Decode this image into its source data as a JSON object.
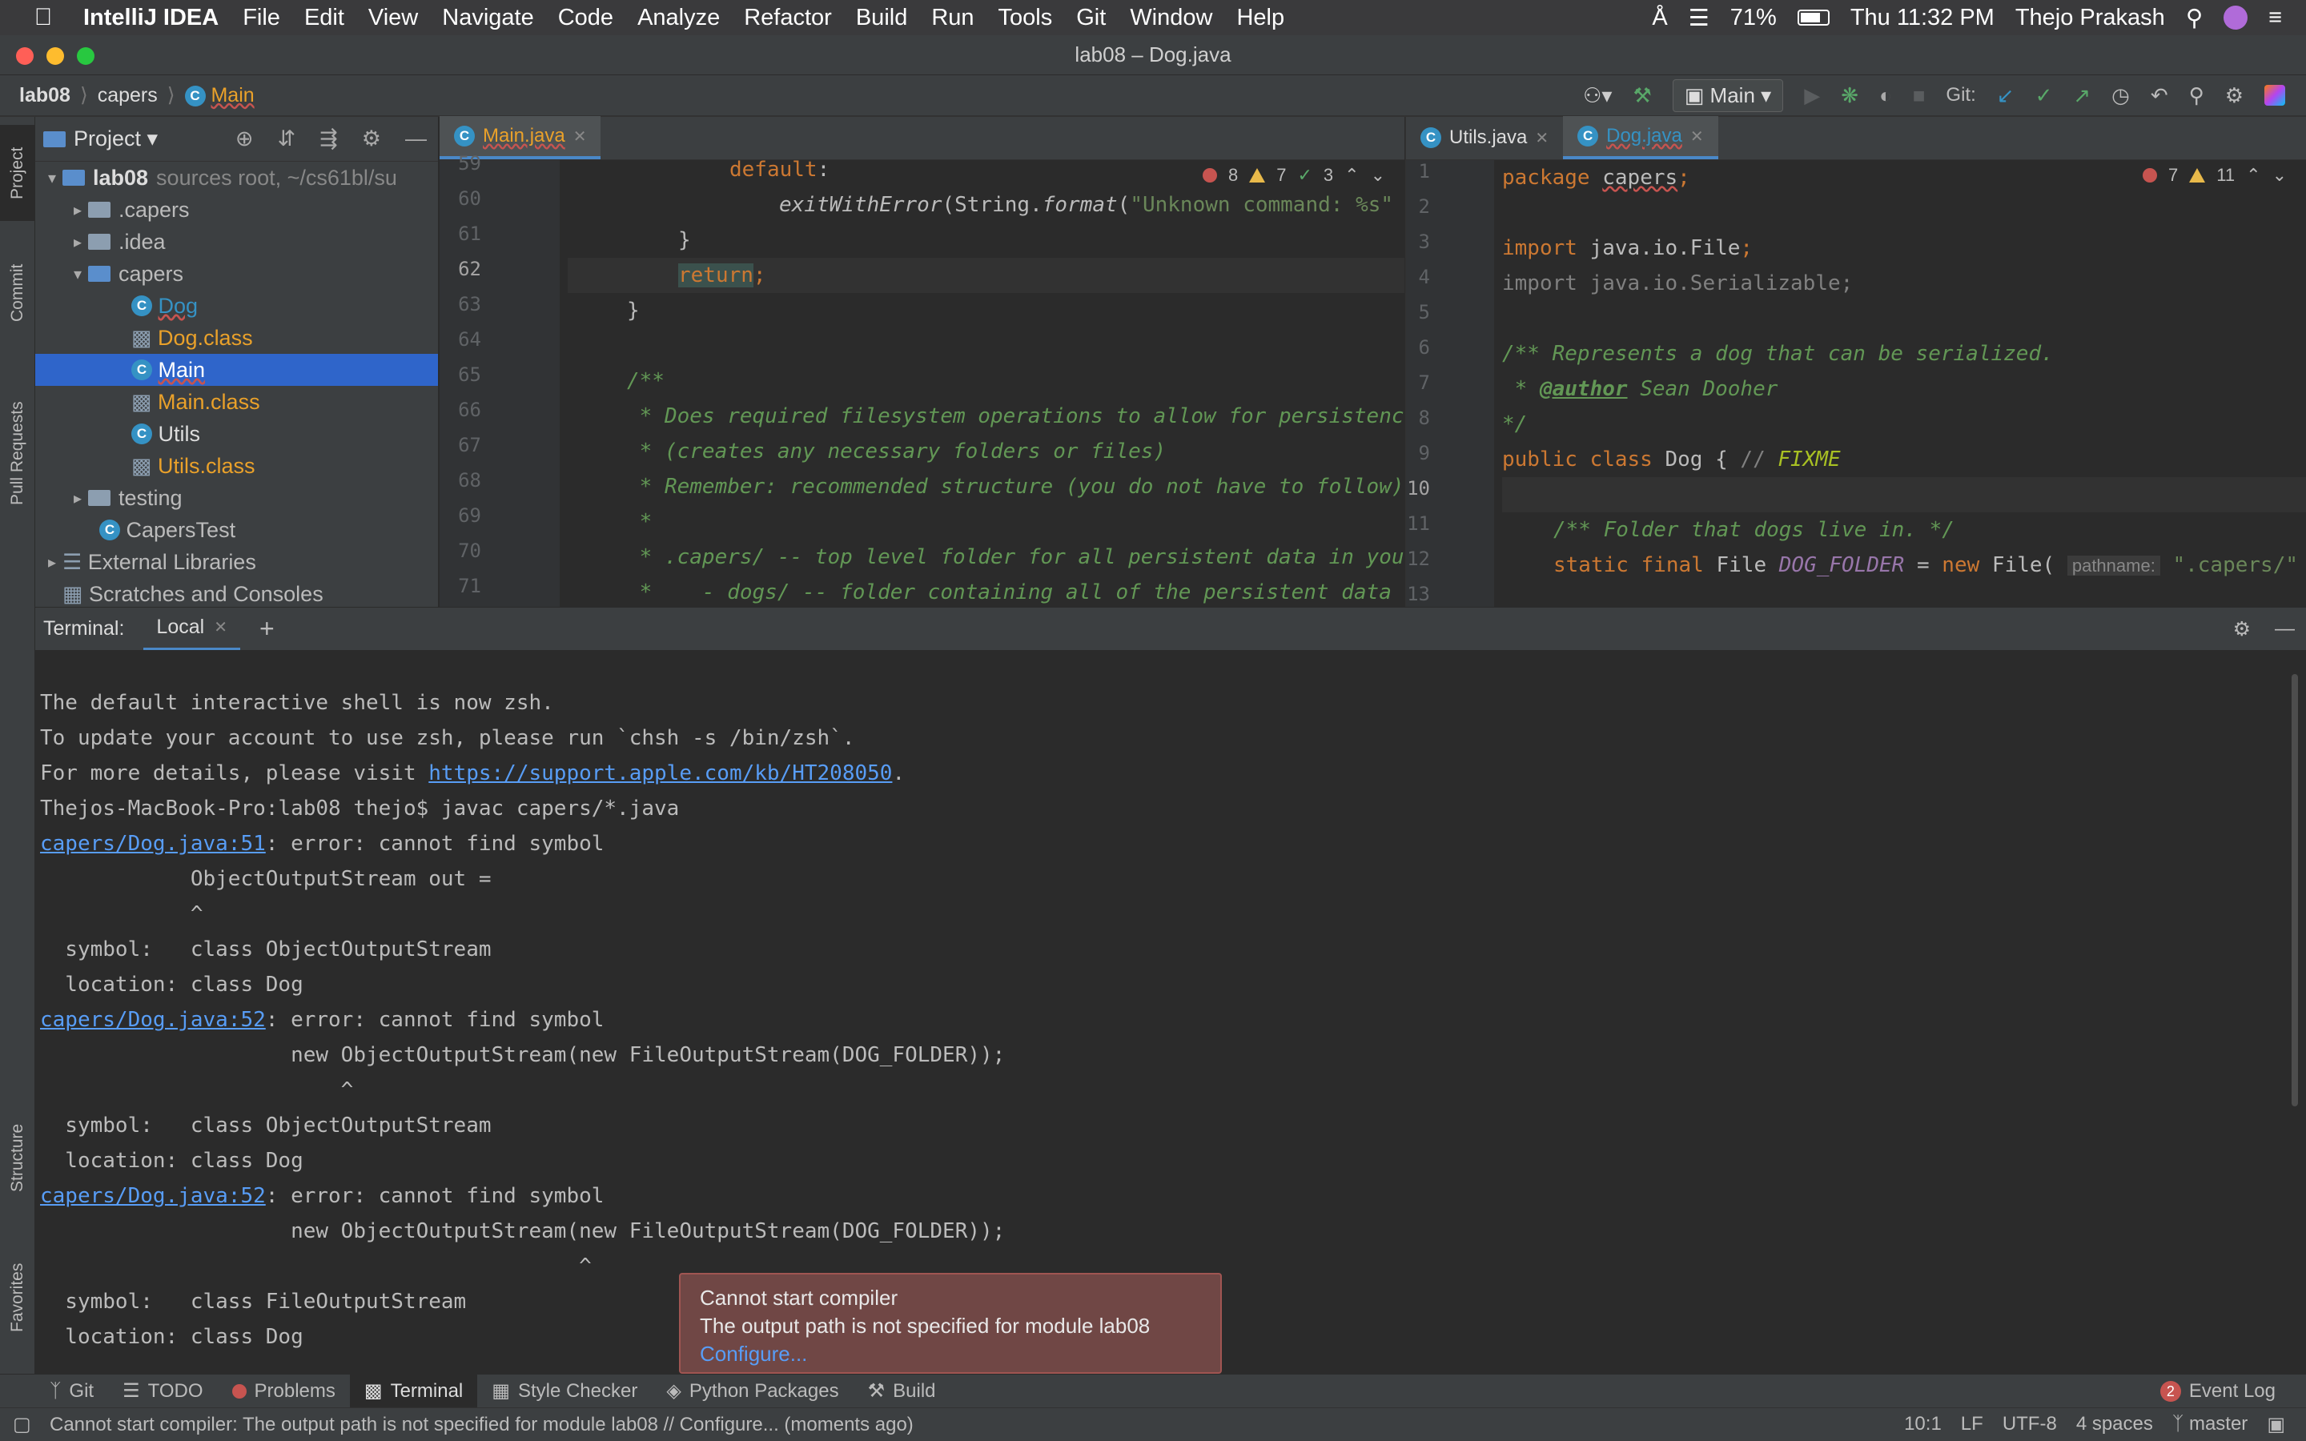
{
  "menubar": {
    "app_name": "IntelliJ IDEA",
    "items": [
      "File",
      "Edit",
      "View",
      "Navigate",
      "Code",
      "Analyze",
      "Refactor",
      "Build",
      "Run",
      "Tools",
      "Git",
      "Window",
      "Help"
    ],
    "battery": "71%",
    "datetime": "Thu 11:32 PM",
    "user": "Thejo Prakash"
  },
  "window_title": "lab08 – Dog.java",
  "breadcrumb": {
    "project": "lab08",
    "package": "capers",
    "file": "Main"
  },
  "toolbar": {
    "run_config": "Main",
    "git_label": "Git:"
  },
  "project_panel": {
    "title": "Project",
    "root": {
      "name": "lab08",
      "hint": "sources root,  ~/cs61bl/su"
    },
    "items": [
      {
        "label": ".capers"
      },
      {
        "label": ".idea"
      },
      {
        "label": "capers"
      },
      {
        "label": "Dog"
      },
      {
        "label": "Dog.class"
      },
      {
        "label": "Main"
      },
      {
        "label": "Main.class"
      },
      {
        "label": "Utils"
      },
      {
        "label": "Utils.class"
      },
      {
        "label": "testing"
      },
      {
        "label": "CapersTest"
      },
      {
        "label": "External Libraries"
      },
      {
        "label": "Scratches and Consoles"
      }
    ]
  },
  "left_tool_tabs": [
    "Project",
    "Commit",
    "Pull Requests",
    "Structure",
    "Favorites"
  ],
  "editor_left": {
    "tab": "Main.java",
    "errors": "8",
    "warnings": "7",
    "ok": "3",
    "line_numbers": [
      "59",
      "60",
      "61",
      "62",
      "63",
      "64",
      "65",
      "66",
      "67",
      "68",
      "69",
      "70",
      "71"
    ]
  },
  "editor_right": {
    "tabs": [
      "Utils.java",
      "Dog.java"
    ],
    "errors": "7",
    "warnings": "11",
    "line_numbers": [
      "1",
      "2",
      "3",
      "4",
      "5",
      "6",
      "7",
      "8",
      "9",
      "10",
      "11",
      "12",
      "13"
    ],
    "param_hint": "pathname:"
  },
  "terminal": {
    "label": "Terminal:",
    "tab": "Local",
    "lines": [
      "The default interactive shell is now zsh.",
      "To update your account to use zsh, please run `chsh -s /bin/zsh`.",
      "For more details, please visit ",
      "https://support.apple.com/kb/HT208050",
      ".",
      "Thejos-MacBook-Pro:lab08 thejo$ javac capers/*.java",
      "capers/Dog.java:51",
      ": error: cannot find symbol",
      "            ObjectOutputStream out =",
      "            ^",
      "  symbol:   class ObjectOutputStream",
      "  location: class Dog",
      "capers/Dog.java:52",
      ": error: cannot find symbol",
      "                    new ObjectOutputStream(new FileOutputStream(DOG_FOLDER));",
      "                        ^",
      "  symbol:   class ObjectOutputStream",
      "  location: class Dog",
      "capers/Dog.java:52",
      ": error: cannot find symbol",
      "                    new ObjectOutputStream(new FileOutputStream(DOG_FOLDER));",
      "                                           ^",
      "  symbol:   class FileOutputStream",
      "  location: class Dog"
    ]
  },
  "toast": {
    "title": "Cannot start compiler",
    "body": "The output path is not specified for module lab08",
    "action": "Configure..."
  },
  "bottom_tools": [
    "Git",
    "TODO",
    "Problems",
    "Terminal",
    "Style Checker",
    "Python Packages",
    "Build"
  ],
  "event_log": {
    "count": "2",
    "label": "Event Log"
  },
  "status": {
    "message": "Cannot start compiler: The output path is not specified for module lab08 // Configure... (moments ago)",
    "position": "10:1",
    "line_sep": "LF",
    "encoding": "UTF-8",
    "indent": "4 spaces",
    "branch": "master"
  },
  "colors": {
    "accent": "#2f65ca",
    "error": "#c75450",
    "link": "#589df6",
    "toast_bg": "#704745"
  }
}
